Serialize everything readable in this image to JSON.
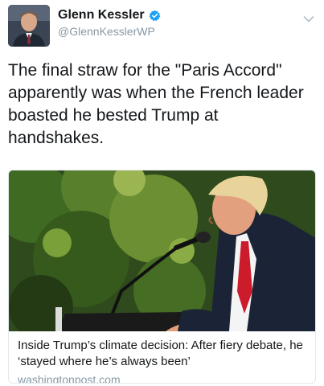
{
  "author": {
    "display_name": "Glenn Kessler",
    "handle": "@GlennKesslerWP",
    "verified": true,
    "avatar_icon": "profile-photo"
  },
  "tweet": {
    "text": "The final straw for the \"Paris Accord\" apparently was when the French leader boasted he bested Trump at handshakes."
  },
  "card": {
    "image_icon": "photo-man-at-podium-with-microphone",
    "title": "Inside Trump’s climate decision: After fiery debate, he ‘stayed where he’s always been’",
    "domain": "washingtonpost.com"
  },
  "colors": {
    "text": "#14171a",
    "secondary": "#8899a6",
    "verified_blue": "#1da1f2",
    "card_border": "#e1e8ed"
  }
}
